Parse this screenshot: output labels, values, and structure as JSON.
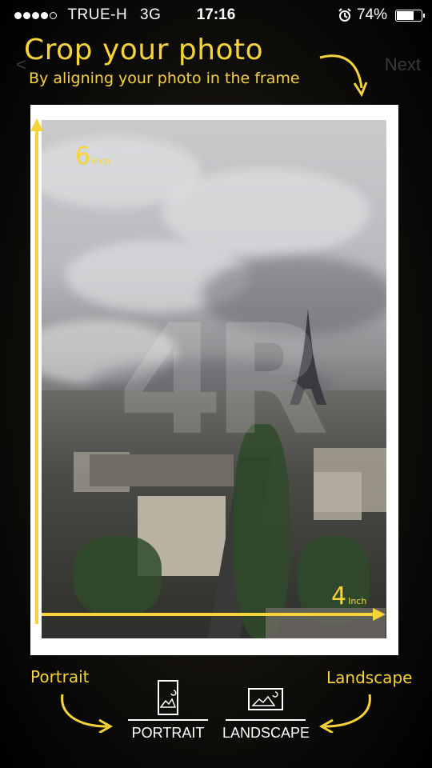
{
  "status_bar": {
    "carrier": "TRUE-H",
    "network": "3G",
    "time": "17:16",
    "battery_percent_label": "74%",
    "battery_level": 0.74
  },
  "header": {
    "title": "Crop your photo",
    "subtitle": "By aligning your photo in the frame",
    "next_label": "Next",
    "back_label": "<"
  },
  "frame": {
    "watermark": "4R",
    "height_value": "6",
    "height_unit": "Inch",
    "width_value": "4",
    "width_unit": "Inch"
  },
  "orientation": {
    "hint_left": "Portrait",
    "hint_right": "Landscape",
    "portrait_label": "PORTRAIT",
    "landscape_label": "LANDSCAPE",
    "portrait_icon": "portrait-photo-icon",
    "landscape_icon": "landscape-photo-icon"
  },
  "colors": {
    "accent": "#f7d33a",
    "background": "#0b0a08"
  }
}
